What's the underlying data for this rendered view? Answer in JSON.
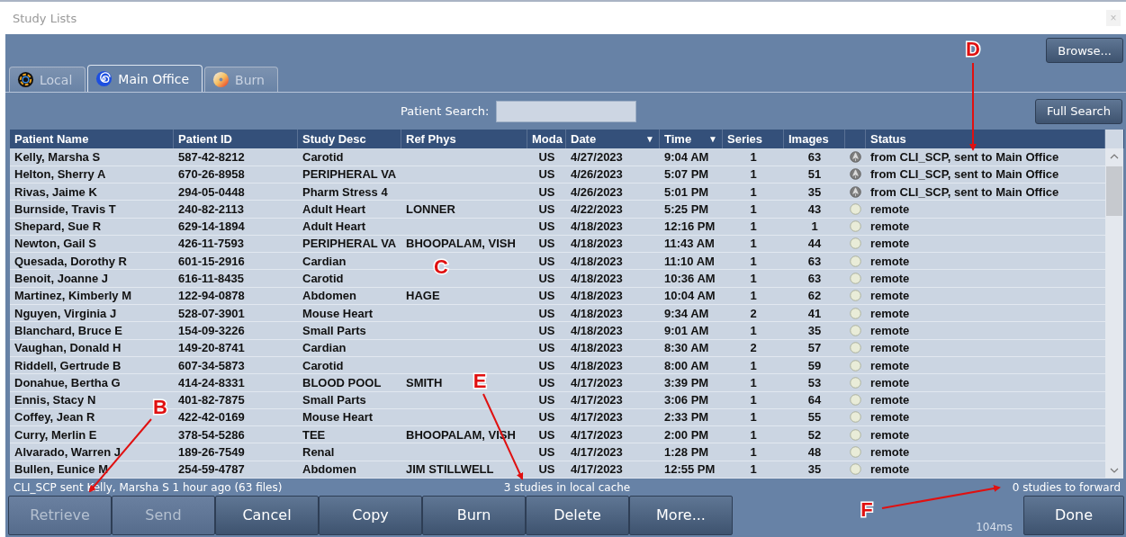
{
  "window": {
    "title": "Study Lists",
    "close": "×"
  },
  "browse_button": "Browse...",
  "tabs": [
    {
      "label": "Local",
      "kind": "local",
      "selected": false
    },
    {
      "label": "Main Office",
      "kind": "office",
      "selected": true
    },
    {
      "label": "Burn",
      "kind": "burn",
      "selected": false
    }
  ],
  "search": {
    "label": "Patient Search:"
  },
  "full_search_button": "Full Search",
  "table": {
    "columns": [
      {
        "label": "Patient Name"
      },
      {
        "label": "Patient ID"
      },
      {
        "label": "Study Desc"
      },
      {
        "label": "Ref Phys"
      },
      {
        "label": "Moda"
      },
      {
        "label": "Date",
        "sort": "▼"
      },
      {
        "label": "Time",
        "sort": "▼"
      },
      {
        "label": "Series"
      },
      {
        "label": "Images"
      },
      {
        "label": "Status"
      }
    ],
    "rows": [
      {
        "cells": [
          "Kelly, Marsha S",
          "587-42-8212",
          "Carotid",
          null,
          "US",
          "4/27/2023",
          "9:04 AM",
          "1",
          "63"
        ],
        "sent": true,
        "status": "from CLI_SCP, sent to Main Office"
      },
      {
        "cells": [
          "Helton, Sherry A",
          "670-26-8958",
          "PERIPHERAL VA",
          null,
          "US",
          "4/26/2023",
          "5:07 PM",
          "1",
          "51"
        ],
        "sent": true,
        "status": "from CLI_SCP, sent to Main Office"
      },
      {
        "cells": [
          "Rivas, Jaime K",
          "294-05-0448",
          "Pharm Stress 4",
          null,
          "US",
          "4/26/2023",
          "5:01 PM",
          "1",
          "35"
        ],
        "sent": true,
        "status": "from CLI_SCP, sent to Main Office"
      },
      {
        "cells": [
          "Burnside, Travis T",
          "240-82-2113",
          "Adult Heart",
          "LONNER",
          "US",
          "4/22/2023",
          "5:25 PM",
          "1",
          "43"
        ],
        "sent": false,
        "status": "remote"
      },
      {
        "cells": [
          "Shepard, Sue R",
          "629-14-1894",
          "Adult Heart",
          null,
          "US",
          "4/18/2023",
          "12:16 PM",
          "1",
          "1"
        ],
        "sent": false,
        "status": "remote"
      },
      {
        "cells": [
          "Newton, Gail S",
          "426-11-7593",
          "PERIPHERAL VA",
          "BHOOPALAM,  VISH",
          "US",
          "4/18/2023",
          "11:43 AM",
          "1",
          "44"
        ],
        "sent": false,
        "status": "remote"
      },
      {
        "cells": [
          "Quesada, Dorothy R",
          "601-15-2916",
          "Cardian",
          null,
          "US",
          "4/18/2023",
          "11:10 AM",
          "1",
          "63"
        ],
        "sent": false,
        "status": "remote"
      },
      {
        "cells": [
          "Benoit, Joanne J",
          "616-11-8435",
          "Carotid",
          null,
          "US",
          "4/18/2023",
          "10:36 AM",
          "1",
          "63"
        ],
        "sent": false,
        "status": "remote"
      },
      {
        "cells": [
          "Martinez, Kimberly M",
          "122-94-0878",
          "Abdomen",
          "HAGE",
          "US",
          "4/18/2023",
          "10:04 AM",
          "1",
          "62"
        ],
        "sent": false,
        "status": "remote"
      },
      {
        "cells": [
          "Nguyen, Virginia J",
          "528-07-3901",
          "Mouse Heart",
          null,
          "US",
          "4/18/2023",
          "9:34 AM",
          "2",
          "41"
        ],
        "sent": false,
        "status": "remote"
      },
      {
        "cells": [
          "Blanchard, Bruce E",
          "154-09-3226",
          "Small Parts",
          null,
          "US",
          "4/18/2023",
          "9:01 AM",
          "1",
          "35"
        ],
        "sent": false,
        "status": "remote"
      },
      {
        "cells": [
          "Vaughan, Donald H",
          "149-20-8741",
          "Cardian",
          null,
          "US",
          "4/18/2023",
          "8:30 AM",
          "2",
          "57"
        ],
        "sent": false,
        "status": "remote"
      },
      {
        "cells": [
          "Riddell, Gertrude B",
          "607-34-5873",
          "Carotid",
          null,
          "US",
          "4/18/2023",
          "8:00 AM",
          "1",
          "59"
        ],
        "sent": false,
        "status": "remote"
      },
      {
        "cells": [
          "Donahue, Bertha G",
          "414-24-8331",
          "BLOOD POOL",
          "SMITH",
          "US",
          "4/17/2023",
          "3:39 PM",
          "1",
          "53"
        ],
        "sent": false,
        "status": "remote"
      },
      {
        "cells": [
          "Ennis, Stacy N",
          "401-82-7875",
          "Small Parts",
          null,
          "US",
          "4/17/2023",
          "3:06 PM",
          "1",
          "64"
        ],
        "sent": false,
        "status": "remote"
      },
      {
        "cells": [
          "Coffey, Jean R",
          "422-42-0169",
          "Mouse Heart",
          null,
          "US",
          "4/17/2023",
          "2:33 PM",
          "1",
          "55"
        ],
        "sent": false,
        "status": "remote"
      },
      {
        "cells": [
          "Curry, Merlin E",
          "378-54-5286",
          "TEE",
          "BHOOPALAM,  VISH",
          "US",
          "4/17/2023",
          "2:00 PM",
          "1",
          "52"
        ],
        "sent": false,
        "status": "remote"
      },
      {
        "cells": [
          "Alvarado, Warren J",
          "189-26-7549",
          "Renal",
          null,
          "US",
          "4/17/2023",
          "1:28 PM",
          "1",
          "48"
        ],
        "sent": false,
        "status": "remote"
      },
      {
        "cells": [
          "Bullen, Eunice M",
          "254-59-4787",
          "Abdomen",
          "JIM STILLWELL",
          "US",
          "4/17/2023",
          "12:55 PM",
          "1",
          "35"
        ],
        "sent": false,
        "status": "remote"
      }
    ]
  },
  "status_bar": {
    "left": "CLI_SCP sent Kelly, Marsha S 1 hour ago (63 files)",
    "center": "3 studies in local cache",
    "right": "0 studies to forward"
  },
  "buttons": [
    {
      "label": "Retrieve",
      "disabled": true
    },
    {
      "label": "Send",
      "disabled": true
    },
    {
      "label": "Cancel",
      "disabled": false
    },
    {
      "label": "Copy",
      "disabled": false
    },
    {
      "label": "Burn",
      "disabled": false
    },
    {
      "label": "Delete",
      "disabled": false
    },
    {
      "label": "More...",
      "disabled": false
    }
  ],
  "timing": "104ms",
  "done_button": "Done",
  "annotations": [
    {
      "label": "B"
    },
    {
      "label": "C"
    },
    {
      "label": "D"
    },
    {
      "label": "E"
    },
    {
      "label": "F"
    }
  ]
}
